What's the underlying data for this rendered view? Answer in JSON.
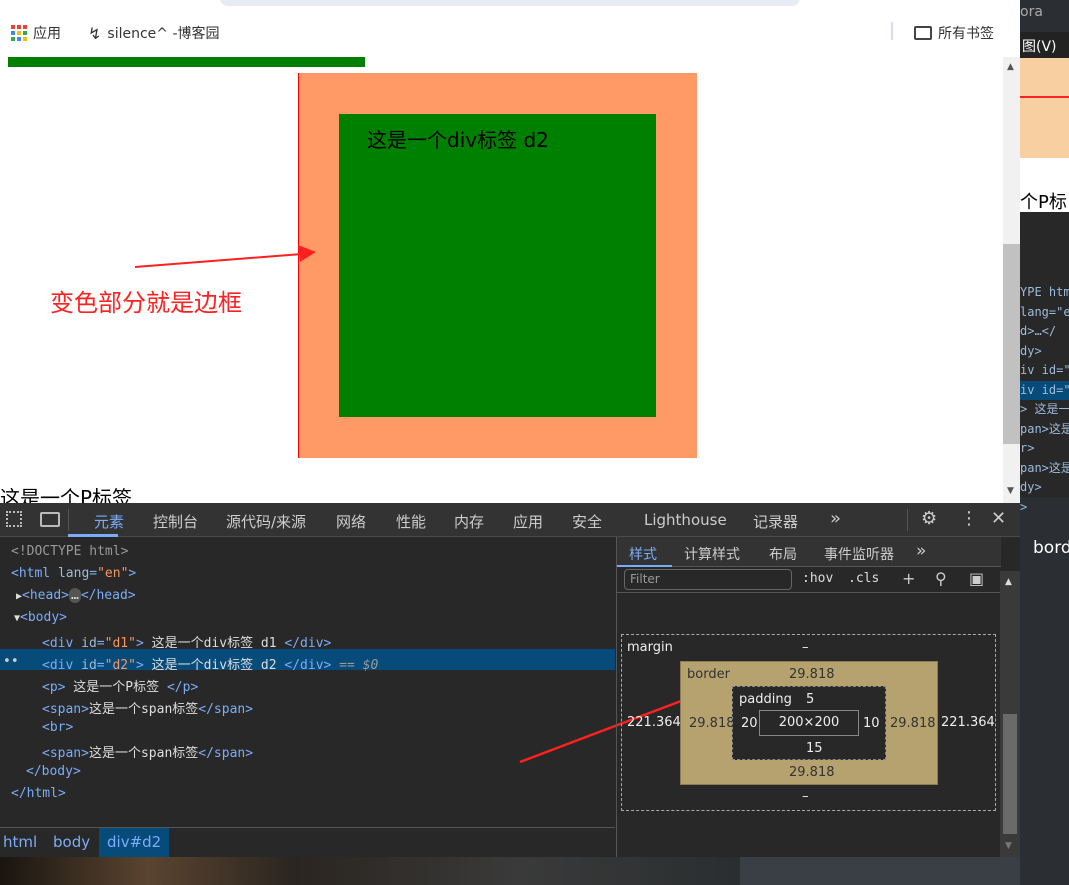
{
  "bookmarks": {
    "apps": "应用",
    "site": "silence^ -博客园",
    "all": "所有书签"
  },
  "right_strip": {
    "t1": "ora",
    "t2": "图(V)",
    "t3": "个P标",
    "t4": "bord",
    "code": [
      "YPE htm",
      "lang=\"e",
      "d>…</",
      "dy>",
      "iv id=\"",
      "iv id=\"",
      "> 这是一",
      "pan>这是",
      "r>",
      "pan>这是",
      "dy>",
      ">"
    ]
  },
  "page": {
    "d2_text": "这是一个div标签 d2",
    "annotation": "变色部分就是边框",
    "p_text": "这是一个P标签",
    "colors": {
      "green": "#008000",
      "border": "#ff9966",
      "red": "#ff2020"
    }
  },
  "devtools": {
    "tabs": [
      "元素",
      "控制台",
      "源代码/来源",
      "网络",
      "性能",
      "内存",
      "应用",
      "安全",
      "Lighthouse",
      "记录器"
    ],
    "more": "»",
    "dom": [
      {
        "p": "<!DOCTYPE html>"
      },
      {
        "open": "<html ",
        "attr": "lang",
        "val": "\"en\"",
        "close": ">"
      },
      {
        "t": "<head>",
        "e": "…",
        "c": "</head>"
      },
      {
        "t": "<body>"
      },
      {
        "open": "<div ",
        "attr": "id",
        "val": "\"d1\"",
        "close": ">",
        "text": " 这是一个div标签 d1 ",
        "end": "</div>"
      },
      {
        "open": "<div ",
        "attr": "id",
        "val": "\"d2\"",
        "close": ">",
        "text": " 这是一个div标签 d2 ",
        "end": "</div>",
        "sel": " == $0"
      },
      {
        "t": "<p>",
        "text": " 这是一个P标签 ",
        "end": "</p>"
      },
      {
        "t": "<span>",
        "text": "这是一个span标签",
        "end": "</span>"
      },
      {
        "t": "<br>"
      },
      {
        "t": "<span>",
        "text": "这是一个span标签",
        "end": "</span>"
      },
      {
        "t": "</body>"
      },
      {
        "t": "</html>"
      }
    ],
    "breadcrumb": [
      "html",
      "body",
      "div#d2"
    ],
    "side_tabs": [
      "样式",
      "计算样式",
      "布局",
      "事件监听器"
    ],
    "filter": "Filter",
    "hov": ":hov",
    ".cls": ".cls",
    "box": {
      "margin_label": "margin",
      "margin_top": "–",
      "margin_bottom": "–",
      "margin_left": "221.364",
      "margin_right": "221.364",
      "border_label": "border",
      "border_top": "29.818",
      "border_bottom": "29.818",
      "border_left": "29.818",
      "border_right": "29.818",
      "padding_label": "padding",
      "padding_top": "5",
      "padding_bottom": "15",
      "padding_left": "20",
      "padding_right": "10",
      "content": "200×200"
    }
  }
}
